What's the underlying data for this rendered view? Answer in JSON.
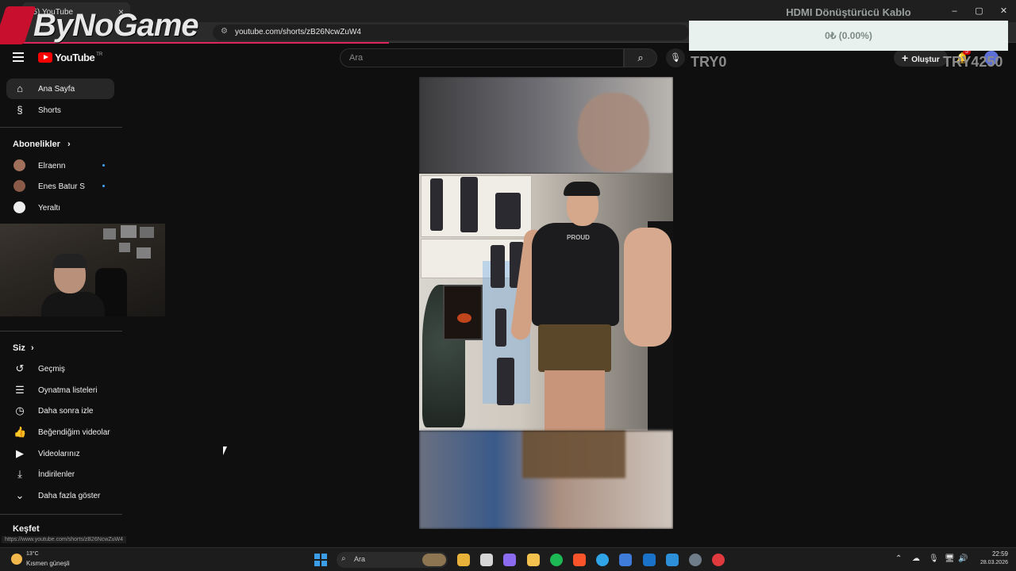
{
  "browser": {
    "tab_title": "(5) YouTube",
    "tab_close": "×",
    "url": "youtube.com/shorts/zB26NcwZuW4",
    "window_controls": [
      "–",
      "▢",
      "✕"
    ]
  },
  "overlay": {
    "logo_text": "ByNoGame",
    "donation_title": "HDMI Dönüştürücü Kablo",
    "donation_amount": "0₺ (0.00%)",
    "try_left": "TRY0",
    "try_right": "TRY4250"
  },
  "header": {
    "logo_text": "YouTube",
    "region": "TR",
    "search_placeholder": "Ara",
    "search_icon": "⌕",
    "mic_icon": "🎙",
    "create_label": "Oluştur",
    "notification_count": "5"
  },
  "sidebar": {
    "main": [
      {
        "label": "Ana Sayfa",
        "icon": "home-icon",
        "glyph": "⌂"
      },
      {
        "label": "Shorts",
        "icon": "shorts-icon",
        "glyph": "§"
      }
    ],
    "subscriptions_title": "Abonelikler",
    "subscriptions": [
      {
        "label": "Elraenn",
        "color": "#a0705a",
        "new": true
      },
      {
        "label": "Enes Batur S",
        "color": "#8a5a48",
        "new": true
      },
      {
        "label": "Yeraltı",
        "color": "#eeeeee",
        "new": false
      }
    ],
    "you_title": "Siz",
    "you_items": [
      {
        "label": "Geçmiş",
        "icon": "history-icon",
        "glyph": "↺"
      },
      {
        "label": "Oynatma listeleri",
        "icon": "playlist-icon",
        "glyph": "☰"
      },
      {
        "label": "Daha sonra izle",
        "icon": "clock-icon",
        "glyph": "◷"
      },
      {
        "label": "Beğendiğim videolar",
        "icon": "thumbs-up-icon",
        "glyph": "👍"
      },
      {
        "label": "Videolarınız",
        "icon": "your-videos-icon",
        "glyph": "▶"
      },
      {
        "label": "İndirilenler",
        "icon": "download-icon",
        "glyph": "⤓"
      },
      {
        "label": "Daha fazla göster",
        "icon": "chevron-down-icon",
        "glyph": "⌄"
      }
    ],
    "explore_title": "Keşfet",
    "chevron": "›"
  },
  "video": {
    "shirt_text": "PROUD"
  },
  "status_url": "https://www.youtube.com/shorts/zB26NcwZuW4",
  "taskbar": {
    "temperature": "13°C",
    "weather": "Kısmen güneşli",
    "search_label": "Ara",
    "time": "22:59",
    "date": "28.03.2026",
    "apps": [
      {
        "name": "file-explorer-icon",
        "color": "#e8b13a"
      },
      {
        "name": "task-view-icon",
        "color": "#d6d6d6"
      },
      {
        "name": "copilot-icon",
        "color": "#8b6cf0"
      },
      {
        "name": "folder-icon",
        "color": "#f2c14e"
      },
      {
        "name": "spotify-icon",
        "color": "#1db954"
      },
      {
        "name": "brave-icon",
        "color": "#fb542b"
      },
      {
        "name": "edge-icon",
        "color": "#2fa4e7"
      },
      {
        "name": "store-icon",
        "color": "#3f7bd9"
      },
      {
        "name": "outlook-icon",
        "color": "#1a73c8"
      },
      {
        "name": "app-icon",
        "color": "#2c8fd8"
      },
      {
        "name": "steam-icon",
        "color": "#6f7c8a"
      },
      {
        "name": "streamlabs-icon",
        "color": "#e03a3e"
      }
    ]
  }
}
